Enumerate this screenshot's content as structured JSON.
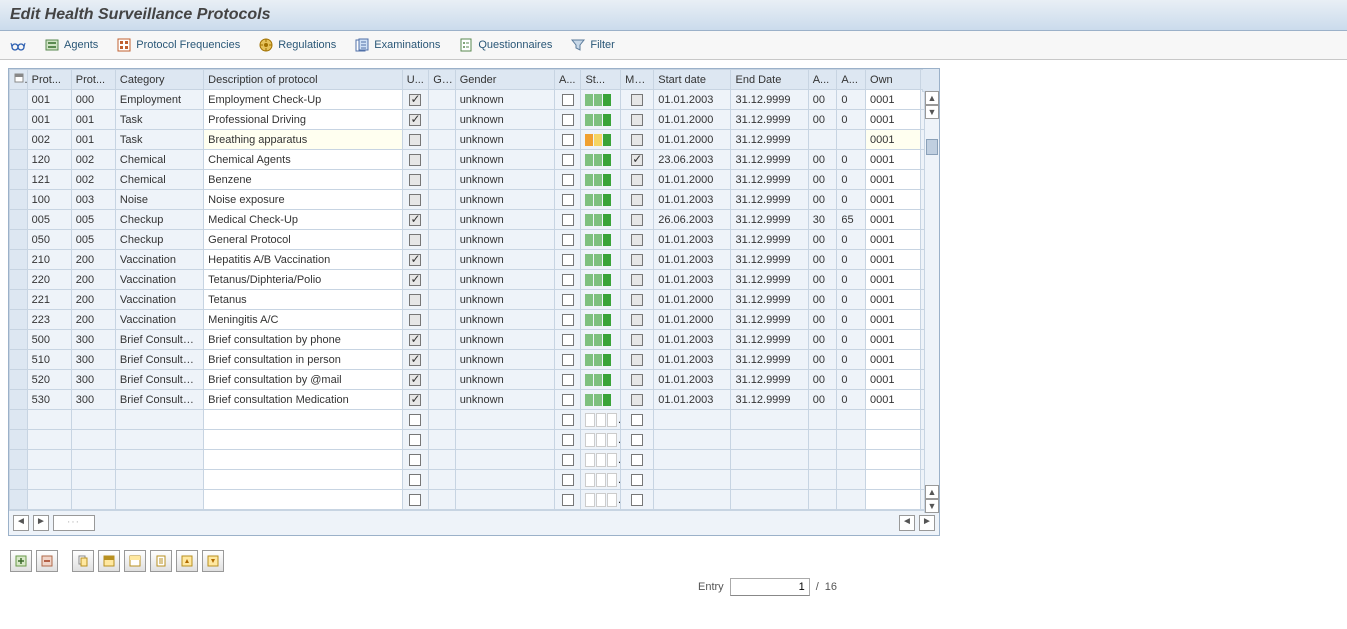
{
  "title": "Edit Health Surveillance Protocols",
  "toolbar": {
    "agents": "Agents",
    "protocol_frequencies": "Protocol Frequencies",
    "regulations": "Regulations",
    "examinations": "Examinations",
    "questionnaires": "Questionnaires",
    "filter": "Filter"
  },
  "columns": {
    "sel": "",
    "prot1": "Prot...",
    "prot2": "Prot...",
    "category": "Category",
    "description": "Description of protocol",
    "u": "U...",
    "g": "G...",
    "gender": "Gender",
    "a": "A...",
    "st": "St...",
    "ma": "Ma...",
    "start_date": "Start date",
    "end_date": "End Date",
    "a2": "A...",
    "a3": "A...",
    "own": "Own"
  },
  "rows": [
    {
      "p1": "001",
      "p2": "000",
      "cat": "Employment",
      "desc": "Employment Check-Up",
      "u": true,
      "gender": "unknown",
      "st": "ggG",
      "ma": false,
      "sd": "01.01.2003",
      "ed": "31.12.9999",
      "a2": "00",
      "a3": "0",
      "own": "0001"
    },
    {
      "p1": "001",
      "p2": "001",
      "cat": "Task",
      "desc": "Professional Driving",
      "u": true,
      "gender": "unknown",
      "st": "ggG",
      "ma": false,
      "sd": "01.01.2000",
      "ed": "31.12.9999",
      "a2": "00",
      "a3": "0",
      "own": "0001"
    },
    {
      "p1": "002",
      "p2": "001",
      "cat": "Task",
      "desc": "Breathing apparatus",
      "u": false,
      "gender": "unknown",
      "st": "oyG",
      "ma": false,
      "sd": "01.01.2000",
      "ed": "31.12.9999",
      "a2": "",
      "a3": "",
      "own": "0001",
      "active": true
    },
    {
      "p1": "120",
      "p2": "002",
      "cat": "Chemical",
      "desc": "Chemical Agents",
      "u": false,
      "gender": "unknown",
      "st": "ggG",
      "ma": true,
      "sd": "23.06.2003",
      "ed": "31.12.9999",
      "a2": "00",
      "a3": "0",
      "own": "0001"
    },
    {
      "p1": "121",
      "p2": "002",
      "cat": "Chemical",
      "desc": "Benzene",
      "u": false,
      "gender": "unknown",
      "st": "ggG",
      "ma": false,
      "sd": "01.01.2000",
      "ed": "31.12.9999",
      "a2": "00",
      "a3": "0",
      "own": "0001"
    },
    {
      "p1": "100",
      "p2": "003",
      "cat": "Noise",
      "desc": "Noise exposure",
      "u": false,
      "gender": "unknown",
      "st": "ggG",
      "ma": false,
      "sd": "01.01.2003",
      "ed": "31.12.9999",
      "a2": "00",
      "a3": "0",
      "own": "0001"
    },
    {
      "p1": "005",
      "p2": "005",
      "cat": "Checkup",
      "desc": "Medical Check-Up",
      "u": true,
      "gender": "unknown",
      "st": "ggG",
      "ma": false,
      "sd": "26.06.2003",
      "ed": "31.12.9999",
      "a2": "30",
      "a3": "65",
      "own": "0001"
    },
    {
      "p1": "050",
      "p2": "005",
      "cat": "Checkup",
      "desc": "General Protocol",
      "u": false,
      "gender": "unknown",
      "st": "ggG",
      "ma": false,
      "sd": "01.01.2003",
      "ed": "31.12.9999",
      "a2": "00",
      "a3": "0",
      "own": "0001"
    },
    {
      "p1": "210",
      "p2": "200",
      "cat": "Vaccination",
      "desc": "Hepatitis A/B Vaccination",
      "u": true,
      "gender": "unknown",
      "st": "ggG",
      "ma": false,
      "sd": "01.01.2003",
      "ed": "31.12.9999",
      "a2": "00",
      "a3": "0",
      "own": "0001"
    },
    {
      "p1": "220",
      "p2": "200",
      "cat": "Vaccination",
      "desc": "Tetanus/Diphteria/Polio",
      "u": true,
      "gender": "unknown",
      "st": "ggG",
      "ma": false,
      "sd": "01.01.2003",
      "ed": "31.12.9999",
      "a2": "00",
      "a3": "0",
      "own": "0001"
    },
    {
      "p1": "221",
      "p2": "200",
      "cat": "Vaccination",
      "desc": "Tetanus",
      "u": false,
      "gender": "unknown",
      "st": "ggG",
      "ma": false,
      "sd": "01.01.2000",
      "ed": "31.12.9999",
      "a2": "00",
      "a3": "0",
      "own": "0001"
    },
    {
      "p1": "223",
      "p2": "200",
      "cat": "Vaccination",
      "desc": "Meningitis A/C",
      "u": false,
      "gender": "unknown",
      "st": "ggG",
      "ma": false,
      "sd": "01.01.2000",
      "ed": "31.12.9999",
      "a2": "00",
      "a3": "0",
      "own": "0001"
    },
    {
      "p1": "500",
      "p2": "300",
      "cat": "Brief Consultation",
      "desc": "Brief consultation by phone",
      "u": true,
      "gender": "unknown",
      "st": "ggG",
      "ma": false,
      "sd": "01.01.2003",
      "ed": "31.12.9999",
      "a2": "00",
      "a3": "0",
      "own": "0001"
    },
    {
      "p1": "510",
      "p2": "300",
      "cat": "Brief Consultation",
      "desc": "Brief consultation in person",
      "u": true,
      "gender": "unknown",
      "st": "ggG",
      "ma": false,
      "sd": "01.01.2003",
      "ed": "31.12.9999",
      "a2": "00",
      "a3": "0",
      "own": "0001"
    },
    {
      "p1": "520",
      "p2": "300",
      "cat": "Brief Consultation",
      "desc": "Brief consultation by @mail",
      "u": true,
      "gender": "unknown",
      "st": "ggG",
      "ma": false,
      "sd": "01.01.2003",
      "ed": "31.12.9999",
      "a2": "00",
      "a3": "0",
      "own": "0001"
    },
    {
      "p1": "530",
      "p2": "300",
      "cat": "Brief Consultation",
      "desc": "Brief consultation Medication",
      "u": true,
      "gender": "unknown",
      "st": "ggG",
      "ma": false,
      "sd": "01.01.2003",
      "ed": "31.12.9999",
      "a2": "00",
      "a3": "0",
      "own": "0001"
    }
  ],
  "empty_rows": 5,
  "footer": {
    "entry_label": "Entry",
    "entry_value": "1",
    "entry_sep": "/",
    "entry_total": "16"
  }
}
